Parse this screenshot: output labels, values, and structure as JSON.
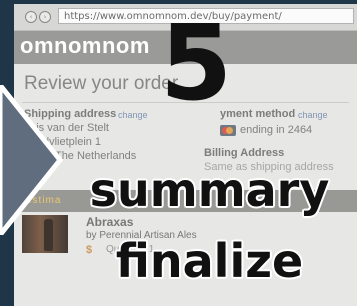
{
  "browser": {
    "url": "https://www.omnomnom.dev/buy/payment/"
  },
  "site": {
    "logo": "omnomnom"
  },
  "checkout": {
    "title": "Review your order",
    "shipping": {
      "label": "Shipping address",
      "change": "change",
      "name": "nnis van der Stelt",
      "street": "Zandvlietplein 1",
      "city": "rdam, The Netherlands"
    },
    "payment": {
      "label": "yment method",
      "change": "change",
      "card_text": "ending in 2464"
    },
    "billing": {
      "label": "Billing Address",
      "same": "Same as shipping address"
    },
    "estimate_band": "estima"
  },
  "product": {
    "name": "Abraxas",
    "maker": "by Perennial Artisan Ales",
    "price": "$",
    "quantity": "Quantity: 1"
  },
  "overlay": {
    "step_number": "5",
    "word_1": "summary",
    "word_2": "finalize"
  },
  "colors": {
    "page_background": "#1f3548",
    "overlay_text": "#111111",
    "accent_link": "#6f87aa"
  },
  "icons": {
    "arrow": "right-arrow-icon",
    "card": "mastercard-icon"
  }
}
